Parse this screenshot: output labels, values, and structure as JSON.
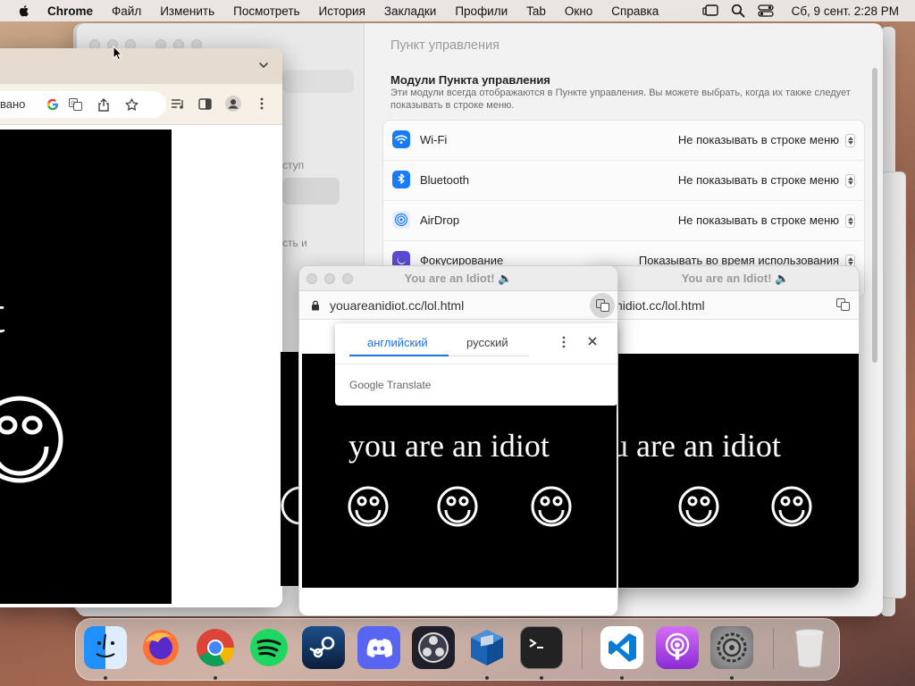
{
  "menubar": {
    "app_name": "Chrome",
    "items": [
      "Файл",
      "Изменить",
      "Посмотреть",
      "История",
      "Закладки",
      "Профили",
      "Tab",
      "Окно",
      "Справка"
    ],
    "clock": "Сб, 9 сент.  2:28 PM"
  },
  "settings": {
    "title": "Пункт управления",
    "section_title": "Модули Пункта управления",
    "section_desc": "Эти модули всегда отображаются в Пункте управления. Вы можете выбрать, когда их также следует показывать в строке меню.",
    "side_frag_1": "ступ",
    "side_frag_2": "сть и",
    "rows": [
      {
        "name": "Wi-Fi",
        "value": "Не показывать в строке меню",
        "icon": "wifi-icon",
        "color": "#1a7cf5"
      },
      {
        "name": "Bluetooth",
        "value": "Не показывать в строке меню",
        "icon": "bluetooth-icon",
        "color": "#1a7cf5"
      },
      {
        "name": "AirDrop",
        "value": "Не показывать в строке меню",
        "icon": "airdrop-icon",
        "color": "#e8eefc"
      },
      {
        "name": "Фокусирование",
        "value": "Показывать во время использования",
        "icon": "moon-icon",
        "color": "#5b4bd6"
      }
    ]
  },
  "chrome": {
    "omnibox_fragment": "вано",
    "page_text": "iot"
  },
  "popups": {
    "title": "You are an Idiot! 🔈",
    "url_mid": "youareanidiot.cc/lol.html",
    "url_back": "nidiot.cc/lol.html",
    "headline": "you are an idiot"
  },
  "translate": {
    "tab_source": "английский",
    "tab_target": "русский",
    "brand": "Google Translate"
  },
  "dock": {
    "apps": [
      "finder",
      "firefox",
      "chrome",
      "spotify",
      "steam",
      "discord",
      "obs",
      "virtualbox",
      "terminal",
      "vscode",
      "podcasts",
      "system-settings",
      "trash"
    ]
  }
}
